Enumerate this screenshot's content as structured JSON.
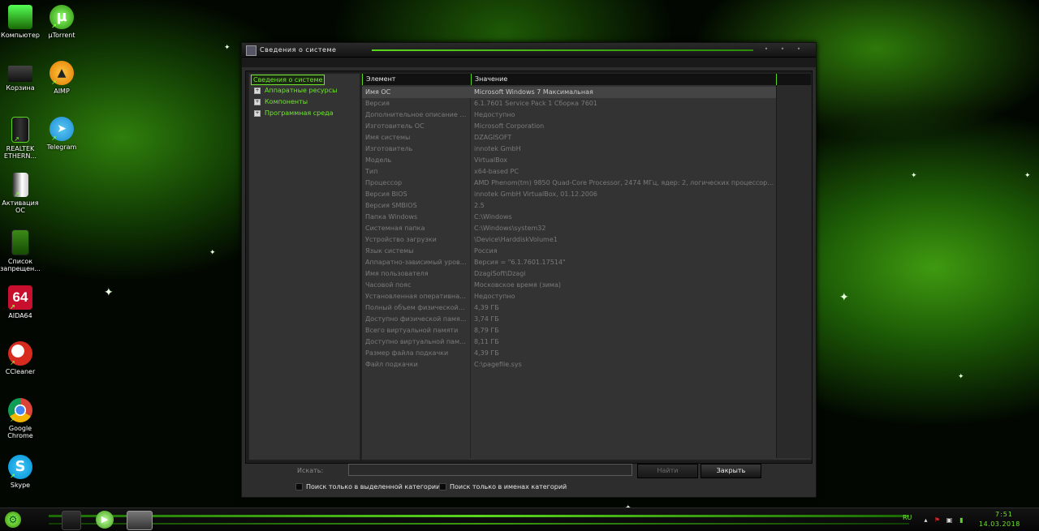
{
  "desktop": {
    "icons": [
      {
        "label": "Компьютер",
        "icon": "computer-icon"
      },
      {
        "label": "µTorrent",
        "icon": "utorrent-icon"
      },
      {
        "label": "Корзина",
        "icon": "recycle-bin-icon"
      },
      {
        "label": "AIMP",
        "icon": "aimp-icon"
      },
      {
        "label": "REALTEK ETHERN...",
        "icon": "realtek-ethernet-icon"
      },
      {
        "label": "Telegram",
        "icon": "telegram-icon"
      },
      {
        "label": "Активация ОС",
        "icon": "activation-icon"
      },
      {
        "label": "Список запрещен...",
        "icon": "document-list-icon"
      },
      {
        "label": "AIDA64",
        "icon": "aida64-icon"
      },
      {
        "label": "CCleaner",
        "icon": "ccleaner-icon"
      },
      {
        "label": "Google Chrome",
        "icon": "chrome-icon"
      },
      {
        "label": "Skype",
        "icon": "skype-icon"
      }
    ]
  },
  "window": {
    "title": "Сведения о системе",
    "menu": [
      "",
      "",
      "",
      ""
    ],
    "tree": {
      "root": "Сведения о системе",
      "children": [
        "Аппаратные ресурсы",
        "Компоненты",
        "Программная среда"
      ]
    },
    "columns": {
      "element": "Элемент",
      "value": "Значение"
    },
    "rows": [
      [
        "Имя ОС",
        "Microsoft Windows 7 Максимальная"
      ],
      [
        "Версия",
        "6.1.7601 Service Pack 1 Сборка 7601"
      ],
      [
        "Дополнительное описание ОС",
        "Недоступно"
      ],
      [
        "Изготовитель ОС",
        "Microsoft Corporation"
      ],
      [
        "Имя системы",
        "DZAGISOFT"
      ],
      [
        "Изготовитель",
        "innotek GmbH"
      ],
      [
        "Модель",
        "VirtualBox"
      ],
      [
        "Тип",
        "x64-based PC"
      ],
      [
        "Процессор",
        "AMD Phenom(tm) 9850 Quad-Core Processor, 2474 МГц, ядер: 2, логических процессоров:..."
      ],
      [
        "Версия BIOS",
        "innotek GmbH VirtualBox, 01.12.2006"
      ],
      [
        "Версия SMBIOS",
        "2.5"
      ],
      [
        "Папка Windows",
        "C:\\Windows"
      ],
      [
        "Системная папка",
        "C:\\Windows\\system32"
      ],
      [
        "Устройство загрузки",
        "\\Device\\HarddiskVolume1"
      ],
      [
        "Язык системы",
        "Россия"
      ],
      [
        "Аппаратно-зависимый уровен...",
        "Версия = \"6.1.7601.17514\""
      ],
      [
        "Имя пользователя",
        "DzagiSoft\\Dzagi"
      ],
      [
        "Часовой пояс",
        "Московское время (зима)"
      ],
      [
        "Установленная оперативная п...",
        "Недоступно"
      ],
      [
        "Полный объем физической п...",
        "4,39 ГБ"
      ],
      [
        "Доступно физической памяти",
        "3,74 ГБ"
      ],
      [
        "Всего виртуальной памяти",
        "8,79 ГБ"
      ],
      [
        "Доступно виртуальной памяти",
        "8,11 ГБ"
      ],
      [
        "Размер файла подкачки",
        "4,39 ГБ"
      ],
      [
        "Файл подкачки",
        "C:\\pagefile.sys"
      ]
    ],
    "search": {
      "label": "Искать:",
      "value": "",
      "find_button": "Найти",
      "close_button": "Закрыть",
      "checkbox_selected_category": "Поиск только в выделенной категории",
      "checkbox_category_names": "Поиск только в именах категорий"
    }
  },
  "taskbar": {
    "language": "RU",
    "time": "7:51",
    "date": "14.03.2018",
    "accent_color": "#5ad61e"
  }
}
